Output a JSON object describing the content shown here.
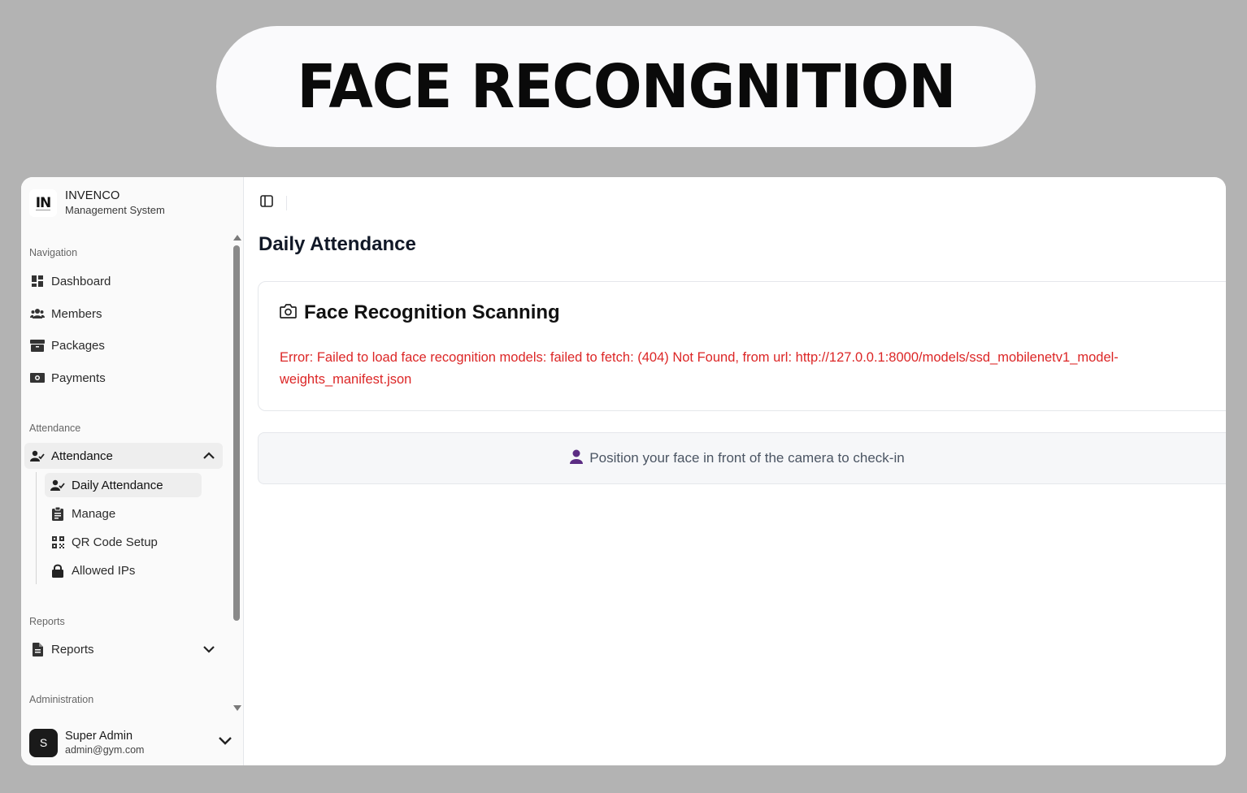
{
  "banner": {
    "title": "FACE RECONGNITION"
  },
  "brand": {
    "logo_text": "IN",
    "name": "INVENCO",
    "subtitle": "Management System"
  },
  "sidebar": {
    "sections": {
      "navigation": "Navigation",
      "attendance": "Attendance",
      "reports": "Reports",
      "administration": "Administration"
    },
    "nav_items": [
      {
        "label": "Dashboard",
        "icon": "dashboard-icon"
      },
      {
        "label": "Members",
        "icon": "users-icon"
      },
      {
        "label": "Packages",
        "icon": "box-icon"
      },
      {
        "label": "Payments",
        "icon": "money-icon"
      }
    ],
    "attendance_group": {
      "label": "Attendance",
      "icon": "user-check-icon",
      "expanded": true
    },
    "attendance_sub": [
      {
        "label": "Daily Attendance",
        "icon": "user-check-icon",
        "active": true
      },
      {
        "label": "Manage",
        "icon": "clipboard-icon"
      },
      {
        "label": "QR Code Setup",
        "icon": "qr-code-icon"
      },
      {
        "label": "Allowed IPs",
        "icon": "lock-icon"
      }
    ],
    "reports_group": {
      "label": "Reports",
      "icon": "file-icon",
      "expanded": false
    }
  },
  "user": {
    "initial": "S",
    "name": "Super Admin",
    "email": "admin@gym.com"
  },
  "main": {
    "page_title": "Daily Attendance",
    "card": {
      "title": "Face Recognition Scanning",
      "icon": "camera-icon",
      "error": "Error: Failed to load face recognition models: failed to fetch: (404) Not Found, from url: http://127.0.0.1:8000/models/ssd_mobilenetv1_model-weights_manifest.json"
    },
    "notice": {
      "icon": "person-icon",
      "text": "Position your face in front of the camera to check-in"
    }
  },
  "colors": {
    "error": "#dc2626",
    "person_icon": "#5b2c83",
    "avatar_bg": "#1a1a1a",
    "page_bg": "#b3b3b3"
  }
}
